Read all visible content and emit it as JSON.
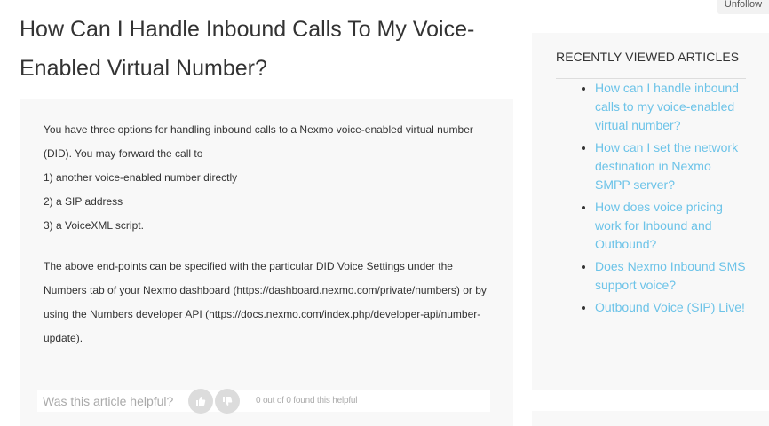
{
  "header": {
    "unfollow_label": "Unfollow"
  },
  "article": {
    "title": "How Can I Handle Inbound Calls To My Voice-Enabled Virtual Number?",
    "paragraphs": [
      "You have three options for handling inbound calls to a Nexmo voice-enabled virtual number (DID). You may forward the call to",
      "1) another voice-enabled number directly",
      "2) a SIP address",
      "3) a VoiceXML script.",
      "The above end-points can be specified with the particular DID Voice Settings under the Numbers tab of your Nexmo dashboard (https://dashboard.nexmo.com/private/numbers) or by using the Numbers developer API (https://docs.nexmo.com/index.php/developer-api/number-update)."
    ]
  },
  "vote": {
    "question": "Was this article helpful?",
    "count_text": "0 out of 0 found this helpful",
    "up_icon": "thumbs-up-icon",
    "down_icon": "thumbs-down-icon"
  },
  "sidebar": {
    "title": "RECENTLY VIEWED ARTICLES",
    "items": [
      {
        "label": "How can I handle inbound calls to my voice-enabled virtual number?"
      },
      {
        "label": "How can I set the network destination in Nexmo SMPP server?"
      },
      {
        "label": "How does voice pricing work for Inbound and Outbound?"
      },
      {
        "label": "Does Nexmo Inbound SMS support voice?"
      },
      {
        "label": "Outbound Voice (SIP) Live!"
      }
    ]
  },
  "colors": {
    "link": "#6cc3e8",
    "panel_bg": "#f8f8f8",
    "text": "#333333",
    "muted": "#aaaaaa"
  }
}
